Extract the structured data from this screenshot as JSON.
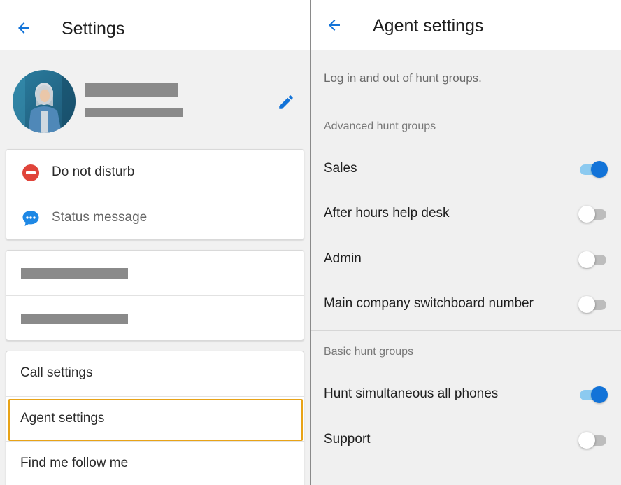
{
  "colors": {
    "accent": "#1273d8",
    "dnd_red": "#e0443a",
    "status_blue": "#1e88e5",
    "selection": "#e8a317"
  },
  "settings": {
    "title": "Settings",
    "back_icon": "arrow-left-icon",
    "edit_icon": "pencil-icon",
    "status_card": {
      "items": [
        {
          "label": "Do not disturb",
          "icon": "do-not-disturb-icon"
        },
        {
          "label": "Status message",
          "icon": "chat-bubble-icon"
        }
      ]
    },
    "menu_card": {
      "items": [
        {
          "label": "Call settings"
        },
        {
          "label": "Agent settings",
          "selected": true
        },
        {
          "label": "Find me follow me"
        }
      ]
    }
  },
  "agent_settings": {
    "title": "Agent settings",
    "description": "Log in and out of hunt groups.",
    "advanced": {
      "heading": "Advanced hunt groups",
      "items": [
        {
          "label": "Sales",
          "on": true
        },
        {
          "label": "After hours help desk",
          "on": false
        },
        {
          "label": "Admin",
          "on": false
        },
        {
          "label": "Main company switchboard number",
          "on": false
        }
      ]
    },
    "basic": {
      "heading": "Basic hunt groups",
      "items": [
        {
          "label": "Hunt simultaneous all phones",
          "on": true
        },
        {
          "label": "Support",
          "on": false
        }
      ]
    }
  }
}
